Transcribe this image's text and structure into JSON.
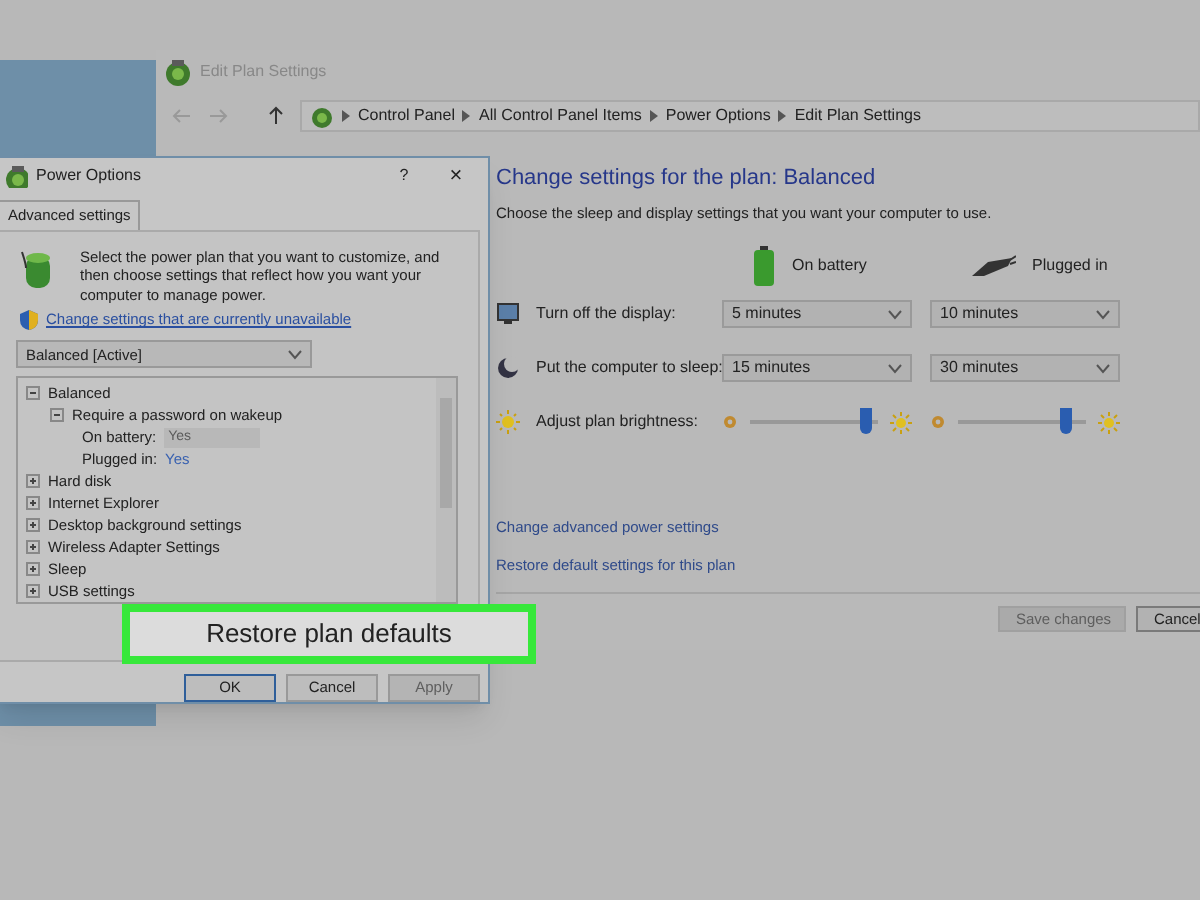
{
  "main_window": {
    "title": "Edit Plan Settings",
    "breadcrumb": [
      "Control Panel",
      "All Control Panel Items",
      "Power Options",
      "Edit Plan Settings"
    ],
    "heading": "Change settings for the plan: Balanced",
    "subheading": "Choose the sleep and display settings that you want your computer to use.",
    "columns": [
      {
        "label": "On battery",
        "kind": "battery"
      },
      {
        "label": "Plugged in",
        "kind": "plug"
      }
    ],
    "settings": [
      {
        "kind": "dropdown",
        "label": "Turn off the display:",
        "values": [
          "5 minutes",
          "10 minutes"
        ]
      },
      {
        "kind": "dropdown",
        "label": "Put the computer to sleep:",
        "values": [
          "15 minutes",
          "30 minutes"
        ]
      },
      {
        "kind": "slider",
        "label": "Adjust plan brightness:",
        "levels": [
          {
            "level": 0.9
          },
          {
            "level": 0.85
          }
        ]
      }
    ],
    "links": [
      "Change advanced power settings",
      "Restore default settings for this plan"
    ],
    "buttons": [
      {
        "label": "Save changes",
        "disabled": true
      },
      {
        "label": "Cancel",
        "disabled": false
      }
    ]
  },
  "dialog": {
    "title": "Power Options",
    "help": "?",
    "close": "×",
    "tabs": [
      {
        "label": "Advanced settings",
        "selected": true
      }
    ],
    "description": "Select the power plan that you want to customize, and then choose settings that reflect how you want your computer to manage power.",
    "link": "Change settings that are currently unavailable",
    "plan": "Balanced [Active]",
    "tree": [
      {
        "label": "Balanced",
        "expanded": true,
        "children": [
          {
            "label": "Require a password on wakeup",
            "expanded": true,
            "children": [
              {
                "label": "On battery:",
                "value": "Yes",
                "disabled": true
              },
              {
                "label": "Plugged in:",
                "value": "Yes",
                "disabled": false
              }
            ]
          }
        ]
      },
      {
        "label": "Hard disk",
        "expanded": false
      },
      {
        "label": "Internet Explorer",
        "expanded": false
      },
      {
        "label": "Desktop background settings",
        "expanded": false
      },
      {
        "label": "Wireless Adapter Settings",
        "expanded": false
      },
      {
        "label": "Sleep",
        "expanded": false
      },
      {
        "label": "USB settings",
        "expanded": false
      }
    ],
    "buttons": [
      {
        "label": "OK",
        "disabled": false,
        "default": true
      },
      {
        "label": "Cancel",
        "disabled": false,
        "default": false
      },
      {
        "label": "Apply",
        "disabled": true,
        "default": false
      }
    ]
  },
  "callout": {
    "label": "Restore plan defaults"
  }
}
